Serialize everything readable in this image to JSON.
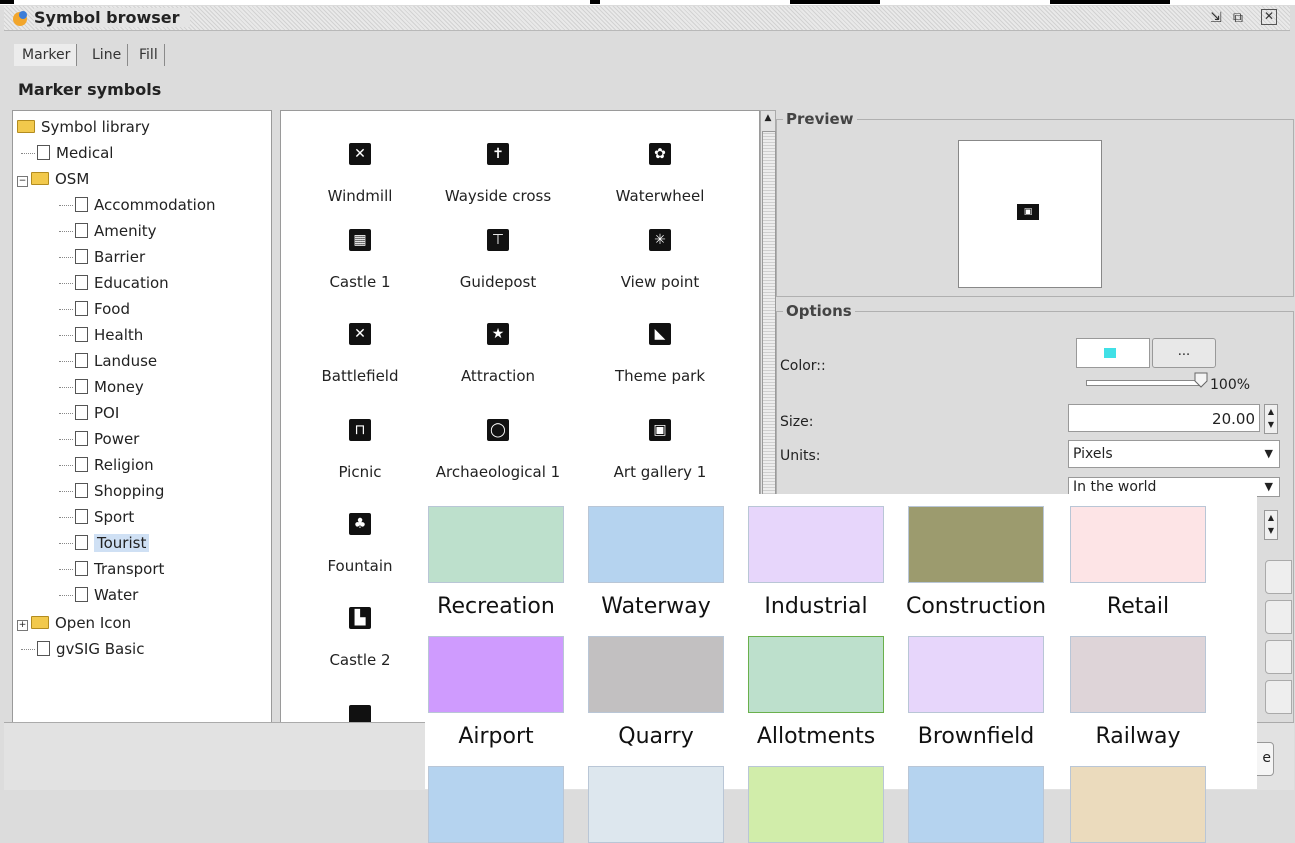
{
  "window": {
    "title": "Symbol browser",
    "controls": [
      "restore-icon",
      "maximize-icon",
      "close-icon"
    ]
  },
  "tabs": [
    {
      "label": "Marker",
      "active": true
    },
    {
      "label": "Line",
      "active": false
    },
    {
      "label": "Fill",
      "active": false
    }
  ],
  "section_title": "Marker symbols",
  "tree": {
    "root": "Symbol library",
    "items": [
      {
        "label": "Medical",
        "type": "doc",
        "level": 1
      },
      {
        "label": "OSM",
        "type": "folder-open",
        "level": 1
      },
      {
        "label": "Accommodation",
        "type": "doc",
        "level": 2
      },
      {
        "label": "Amenity",
        "type": "doc",
        "level": 2
      },
      {
        "label": "Barrier",
        "type": "doc",
        "level": 2
      },
      {
        "label": "Education",
        "type": "doc",
        "level": 2
      },
      {
        "label": "Food",
        "type": "doc",
        "level": 2
      },
      {
        "label": "Health",
        "type": "doc",
        "level": 2
      },
      {
        "label": "Landuse",
        "type": "doc",
        "level": 2
      },
      {
        "label": "Money",
        "type": "doc",
        "level": 2
      },
      {
        "label": "POI",
        "type": "doc",
        "level": 2
      },
      {
        "label": "Power",
        "type": "doc",
        "level": 2
      },
      {
        "label": "Religion",
        "type": "doc",
        "level": 2
      },
      {
        "label": "Shopping",
        "type": "doc",
        "level": 2
      },
      {
        "label": "Sport",
        "type": "doc",
        "level": 2
      },
      {
        "label": "Tourist",
        "type": "doc",
        "level": 2,
        "selected": true
      },
      {
        "label": "Transport",
        "type": "doc",
        "level": 2
      },
      {
        "label": "Water",
        "type": "doc",
        "level": 2
      },
      {
        "label": "Open Icon",
        "type": "folder",
        "level": 1
      },
      {
        "label": "gvSIG Basic",
        "type": "doc",
        "level": 1
      }
    ]
  },
  "symbols": [
    {
      "label": "Windmill",
      "icon": "windmill-icon"
    },
    {
      "label": "Wayside cross",
      "icon": "wayside-cross-icon"
    },
    {
      "label": "Waterwheel",
      "icon": "waterwheel-icon"
    },
    {
      "label": "Castle 1",
      "icon": "castle-icon"
    },
    {
      "label": "Guidepost",
      "icon": "guidepost-icon"
    },
    {
      "label": "View point",
      "icon": "view-point-icon"
    },
    {
      "label": "Battlefield",
      "icon": "battlefield-icon"
    },
    {
      "label": "Attraction",
      "icon": "star-icon"
    },
    {
      "label": "Theme park",
      "icon": "theme-park-icon"
    },
    {
      "label": "Picnic",
      "icon": "picnic-table-icon"
    },
    {
      "label": "Archaeological 1",
      "icon": "archaeological-icon"
    },
    {
      "label": "Art gallery 1",
      "icon": "art-gallery-icon"
    },
    {
      "label": "Fountain",
      "icon": "fountain-icon"
    },
    {
      "label": "",
      "icon": ""
    },
    {
      "label": "",
      "icon": ""
    },
    {
      "label": "Castle 2",
      "icon": "castle-2-icon"
    }
  ],
  "preview": {
    "legend": "Preview",
    "icon": "art-gallery-icon"
  },
  "options": {
    "legend": "Options",
    "color_label": "Color::",
    "color_value": "#40e0e6",
    "more_button": "...",
    "alpha": "100%",
    "size_label": "Size:",
    "size_value": "20.00",
    "units_label": "Units:",
    "units_value": "Pixels",
    "scope_value": "In the world"
  },
  "landuse_overlay": {
    "rows": [
      [
        {
          "label": "Recreation",
          "color": "#bde0cc"
        },
        {
          "label": "Waterway",
          "color": "#b5d3ef"
        },
        {
          "label": "Industrial",
          "color": "#e7d6fb"
        },
        {
          "label": "Construction",
          "color": "#9c9b6e"
        },
        {
          "label": "Retail",
          "color": "#fde4e6"
        }
      ],
      [
        {
          "label": "Airport",
          "color": "#cf9bfe"
        },
        {
          "label": "Quarry",
          "color": "#c2c0c1"
        },
        {
          "label": "Allotments",
          "color": "#bde0cc"
        },
        {
          "label": "Brownfield",
          "color": "#e7d6fb"
        },
        {
          "label": "Railway",
          "color": "#ded4d8"
        }
      ],
      [
        {
          "label": "",
          "color": "#b5d3ef"
        },
        {
          "label": "",
          "color": "#dde7ee"
        },
        {
          "label": "",
          "color": "#d1edaa"
        },
        {
          "label": "",
          "color": "#b5d3ef"
        },
        {
          "label": "",
          "color": "#ebdbbd"
        }
      ]
    ]
  }
}
